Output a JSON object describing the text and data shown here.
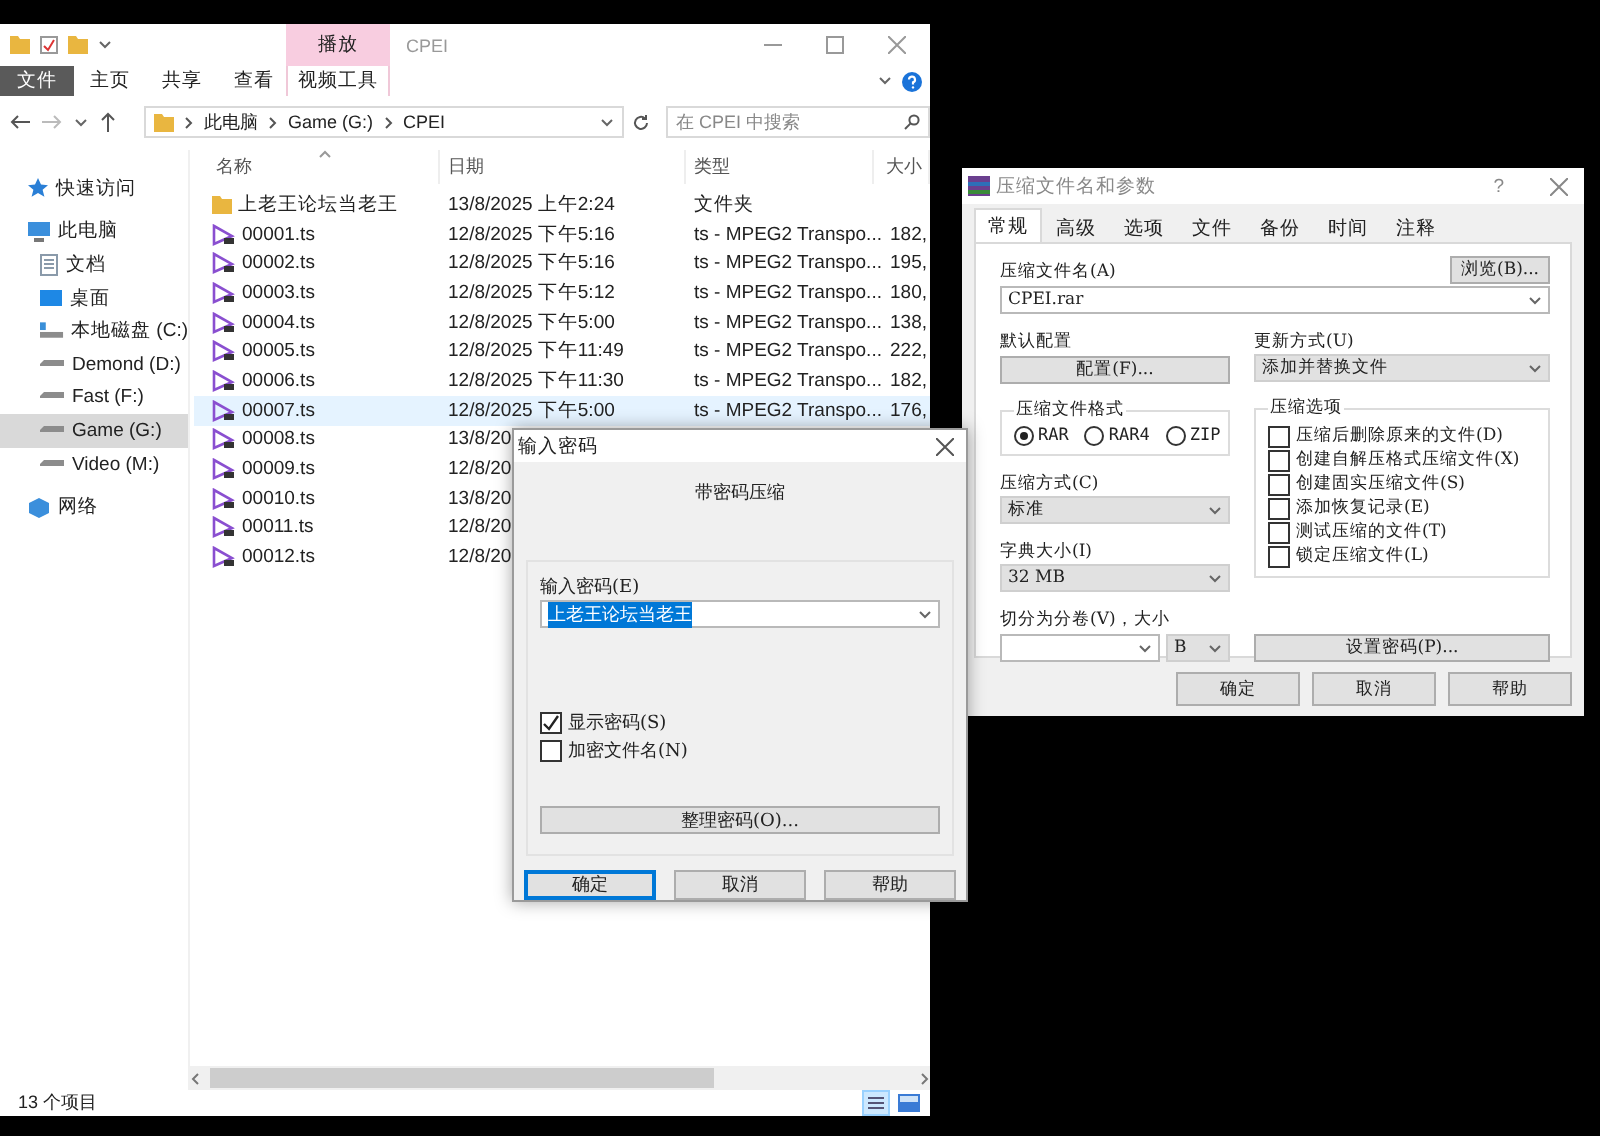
{
  "explorer": {
    "context_tab": "播放",
    "title": "CPEI",
    "ribbon_tabs": [
      {
        "label": "文件",
        "kind": "file"
      },
      {
        "label": "主页",
        "kind": "tab"
      },
      {
        "label": "共享",
        "kind": "tab"
      },
      {
        "label": "查看",
        "kind": "tab"
      },
      {
        "label": "视频工具",
        "kind": "context"
      }
    ],
    "breadcrumb": [
      "此电脑",
      "Game (G:)",
      "CPEI"
    ],
    "search": {
      "placeholder": "在 CPEI 中搜索"
    },
    "nav": [
      {
        "label": "快速访问",
        "kind": "quick",
        "selected": false
      },
      {
        "label": "此电脑",
        "kind": "pc",
        "selected": false,
        "children": [
          {
            "label": "文档",
            "kind": "docs",
            "selected": false
          },
          {
            "label": "桌面",
            "kind": "desktop",
            "selected": false
          },
          {
            "label": "本地磁盘 (C:)",
            "kind": "system",
            "selected": false
          },
          {
            "label": "Demond (D:)",
            "kind": "drive",
            "selected": false
          },
          {
            "label": "Fast (F:)",
            "kind": "drive",
            "selected": false
          },
          {
            "label": "Game (G:)",
            "kind": "drive",
            "selected": true
          },
          {
            "label": "Video (M:)",
            "kind": "drive",
            "selected": false
          }
        ]
      },
      {
        "label": "网络",
        "kind": "network",
        "selected": false
      }
    ],
    "columns": [
      "名称",
      "日期",
      "类型",
      "大小"
    ],
    "rows": [
      {
        "kind": "folder",
        "name": "上老王论坛当老王",
        "date": "13/8/2025 上午2:24",
        "type": "文件夹",
        "selected": false
      },
      {
        "kind": "video",
        "name": "00001.ts",
        "date": "12/8/2025 下午5:16",
        "type": "ts - MPEG2 Transpo...",
        "size": "182,",
        "selected": false
      },
      {
        "kind": "video",
        "name": "00002.ts",
        "date": "12/8/2025 下午5:16",
        "type": "ts - MPEG2 Transpo...",
        "size": "195,",
        "selected": false
      },
      {
        "kind": "video",
        "name": "00003.ts",
        "date": "12/8/2025 下午5:12",
        "type": "ts - MPEG2 Transpo...",
        "size": "180,",
        "selected": false
      },
      {
        "kind": "video",
        "name": "00004.ts",
        "date": "12/8/2025 下午5:00",
        "type": "ts - MPEG2 Transpo...",
        "size": "138,",
        "selected": false
      },
      {
        "kind": "video",
        "name": "00005.ts",
        "date": "12/8/2025 下午11:49",
        "type": "ts - MPEG2 Transpo...",
        "size": "222,",
        "selected": false
      },
      {
        "kind": "video",
        "name": "00006.ts",
        "date": "12/8/2025 下午11:30",
        "type": "ts - MPEG2 Transpo...",
        "size": "182,",
        "selected": false
      },
      {
        "kind": "video",
        "name": "00007.ts",
        "date": "12/8/2025 下午5:00",
        "type": "ts - MPEG2 Transpo...",
        "size": "176,",
        "selected": true
      },
      {
        "kind": "video",
        "name": "00008.ts",
        "date": "13/8/20",
        "selected": false
      },
      {
        "kind": "video",
        "name": "00009.ts",
        "date": "12/8/20",
        "selected": false
      },
      {
        "kind": "video",
        "name": "00010.ts",
        "date": "13/8/20",
        "selected": false
      },
      {
        "kind": "video",
        "name": "00011.ts",
        "date": "12/8/20",
        "selected": false
      },
      {
        "kind": "video",
        "name": "00012.ts",
        "date": "12/8/20",
        "selected": false
      }
    ],
    "status": "13 个项目"
  },
  "password_dialog": {
    "title": "输入密码",
    "subtitle": "带密码压缩",
    "password": {
      "label": "输入密码(E)",
      "value": "上老王论坛当老王",
      "kind": "editable",
      "highlighted": true
    },
    "checkboxes": [
      {
        "label": "显示密码(S)",
        "checked": true
      },
      {
        "label": "加密文件名(N)",
        "checked": false
      }
    ],
    "organize_button": "整理密码(O)...",
    "buttons": [
      {
        "label": "确定",
        "default": true
      },
      {
        "label": "取消",
        "default": false
      },
      {
        "label": "帮助",
        "default": false
      }
    ]
  },
  "archive_dialog": {
    "title": "压缩文件名和参数",
    "help_button": "?",
    "tabs": [
      {
        "label": "常规",
        "selected": true
      },
      {
        "label": "高级",
        "selected": false
      },
      {
        "label": "选项",
        "selected": false
      },
      {
        "label": "文件",
        "selected": false
      },
      {
        "label": "备份",
        "selected": false
      },
      {
        "label": "时间",
        "selected": false
      },
      {
        "label": "注释",
        "selected": false
      }
    ],
    "archive_name": {
      "label": "压缩文件名(A)",
      "value": "CPEI.rar",
      "kind": "editable"
    },
    "browse_button": "浏览(B)...",
    "profile": {
      "label": "默认配置",
      "button": "配置(F)..."
    },
    "update_mode": {
      "label": "更新方式(U)",
      "value": "添加并替换文件",
      "kind": "list"
    },
    "format": {
      "title": "压缩文件格式",
      "options": [
        {
          "label": "RAR",
          "selected": true
        },
        {
          "label": "RAR4",
          "selected": false
        },
        {
          "label": "ZIP",
          "selected": false
        }
      ]
    },
    "options": {
      "title": "压缩选项",
      "items": [
        {
          "label": "压缩后删除原来的文件(D)",
          "checked": false
        },
        {
          "label": "创建自解压格式压缩文件(X)",
          "checked": false
        },
        {
          "label": "创建固实压缩文件(S)",
          "checked": false
        },
        {
          "label": "添加恢复记录(E)",
          "checked": false
        },
        {
          "label": "测试压缩的文件(T)",
          "checked": false
        },
        {
          "label": "锁定压缩文件(L)",
          "checked": false
        }
      ]
    },
    "method": {
      "label": "压缩方式(C)",
      "value": "标准",
      "kind": "list"
    },
    "dictionary": {
      "label": "字典大小(I)",
      "value": "32 MB",
      "kind": "list"
    },
    "split": {
      "label": "切分为分卷(V)，大小",
      "size": {
        "kind": "editable"
      },
      "unit": {
        "value": "B",
        "kind": "list"
      }
    },
    "password_button": "设置密码(P)...",
    "buttons": [
      {
        "label": "确定",
        "default": false
      },
      {
        "label": "取消",
        "default": false
      },
      {
        "label": "帮助",
        "default": false
      }
    ]
  }
}
